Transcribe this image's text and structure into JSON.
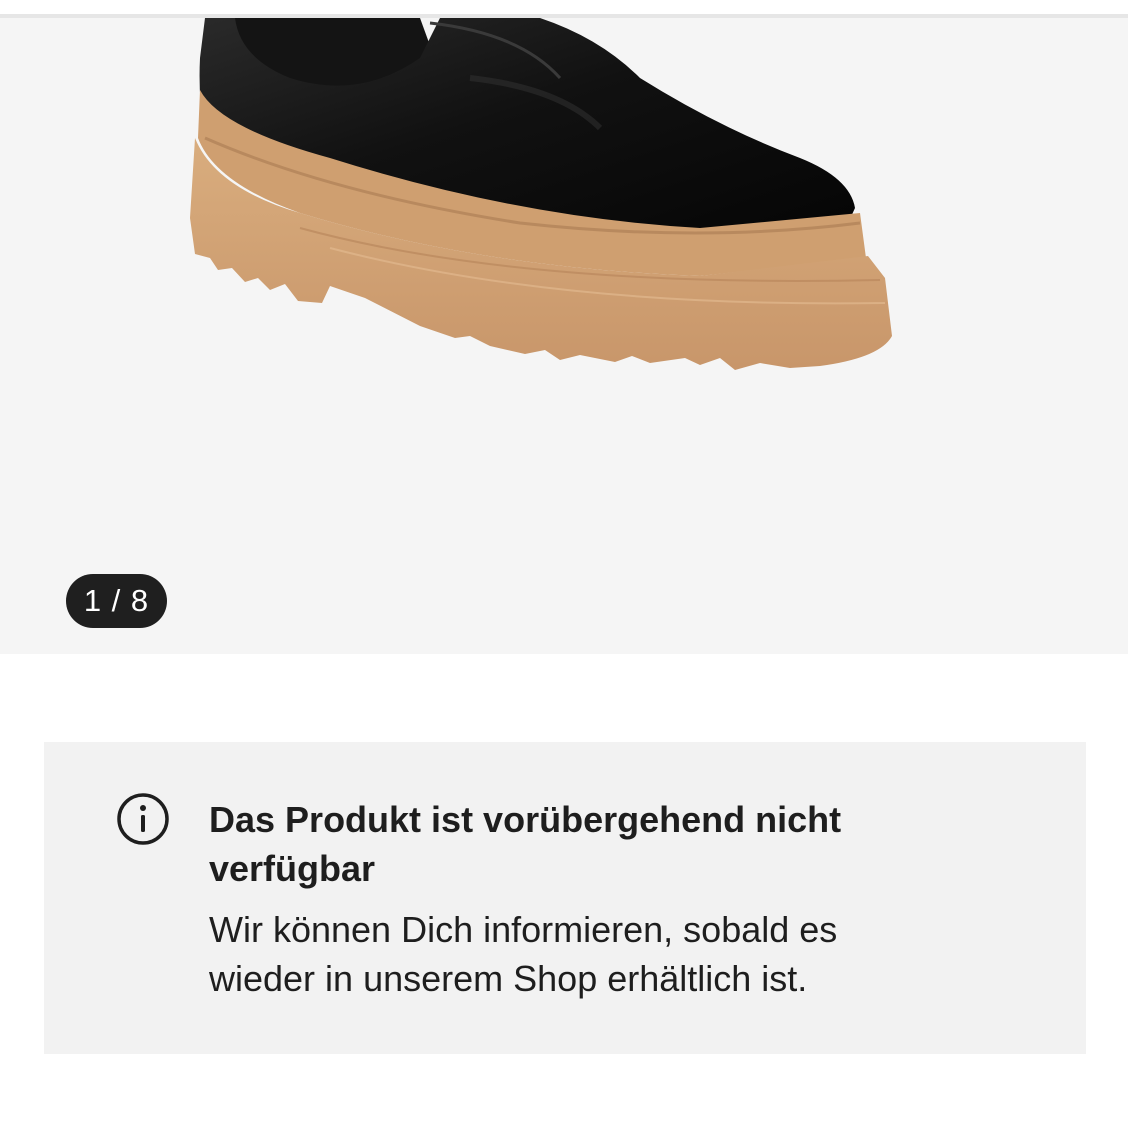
{
  "gallery": {
    "image_alt": "Schwarzer Lederstiefel mit heller Plateausohle",
    "counter": "1 / 8"
  },
  "notice": {
    "icon": "info-icon",
    "title": "Das Produkt ist vorübergehend nicht verfügbar",
    "body": "Wir können Dich informieren, sobald es wieder in unserem Shop erhältlich ist."
  },
  "next_section": {
    "heading_fragment": ""
  }
}
